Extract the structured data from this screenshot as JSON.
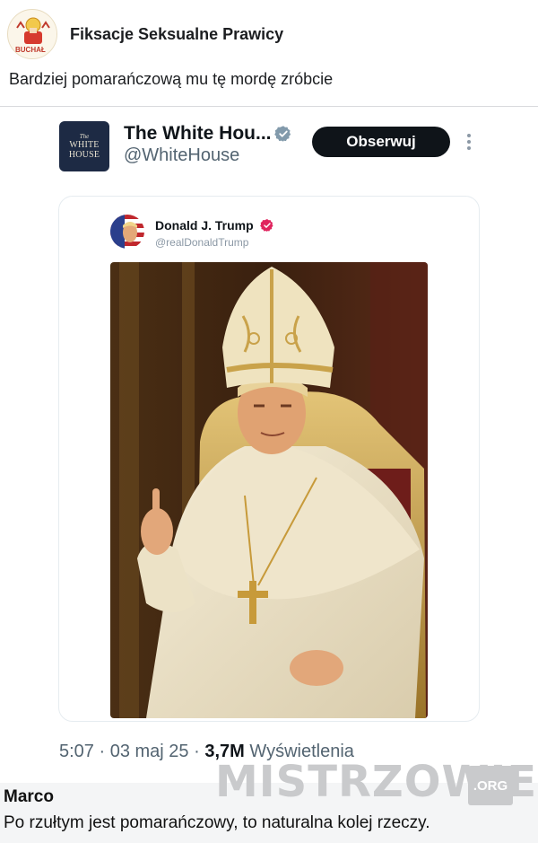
{
  "post": {
    "group_name": "Fiksacje Seksualne Prawicy",
    "group_avatar_icon": "church-emblem-icon",
    "group_avatar_text": "BUCHAŁ",
    "text": "Bardziej pomarańczową mu tę mordę zróbcie"
  },
  "tweet": {
    "avatar_small": "The",
    "avatar_line1": "WHITE",
    "avatar_line2": "HOUSE",
    "name": "The White Hou...",
    "handle": "@WhiteHouse",
    "follow_label": "Obserwuj",
    "time": "5:07",
    "date": "03 maj 25",
    "views_count": "3,7M",
    "views_label": "Wyświetlenia",
    "verified_color": "#829aab"
  },
  "quoted": {
    "name": "Donald J. Trump",
    "handle": "@realDonaldTrump",
    "verified_color": "#e0245e",
    "image_description_icon": "pope-portrait-image"
  },
  "watermark": {
    "text": "MISTRZOWIE",
    "tld": ".ORG"
  },
  "comment": {
    "author": "Marco",
    "text": "Po rzułtym jest pomarańczowy, to naturalna kolej rzeczy."
  }
}
